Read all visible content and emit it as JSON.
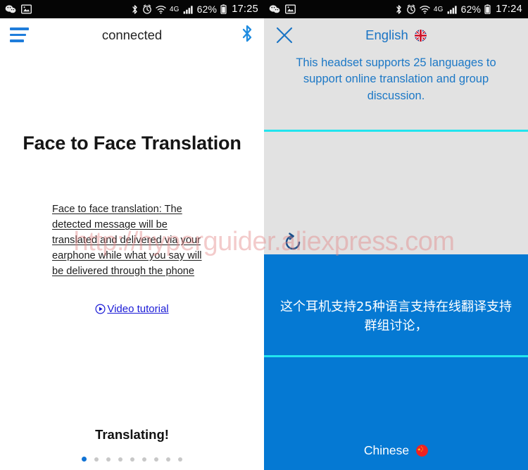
{
  "watermark": {
    "text": "http://hyperguider.aliexpress.com"
  },
  "left_phone": {
    "statusbar": {
      "left_icons": [
        "wechat-icon",
        "gallery-icon"
      ],
      "right_icons": [
        "bluetooth-icon",
        "alarm-icon",
        "wifi-icon"
      ],
      "network": "4G",
      "battery_percent": "62%",
      "time": "17:25"
    },
    "appbar": {
      "menu_icon": "hamburger-menu-icon",
      "title": "connected",
      "bluetooth_icon": "bluetooth-icon"
    },
    "title": "Face to Face Translation",
    "description": "Face to face translation: The detected message will be translated and delivered via your earphone while what you say will be delivered through the phone",
    "video_link": {
      "icon": "play-circle-icon",
      "label": "Video tutorial"
    },
    "status_text": "Translating!",
    "pager": {
      "total": 9,
      "active_index": 0
    }
  },
  "right_phone": {
    "statusbar": {
      "left_icons": [
        "wechat-icon",
        "gallery-icon"
      ],
      "right_icons": [
        "bluetooth-icon",
        "alarm-icon",
        "wifi-icon"
      ],
      "network": "4G",
      "battery_percent": "62%",
      "time": "17:24"
    },
    "topbar": {
      "close_icon": "close-x-icon",
      "language": "English",
      "flag_icon": "uk-flag-icon"
    },
    "english_message": "This headset supports 25 languages to support online translation and group discussion.",
    "refresh_icon": "refresh-icon",
    "chinese_message": "这个耳机支持25种语言支持在线翻译支持群组讨论，",
    "bottom_language": "Chinese",
    "bottom_flag_icon": "china-flag-icon"
  },
  "colors": {
    "accent_blue": "#0579d3",
    "link_blue": "#1a1ad6",
    "cyan_divider": "#22e4ee",
    "panel_gray": "#e2e2e2",
    "status_black": "#050505"
  }
}
